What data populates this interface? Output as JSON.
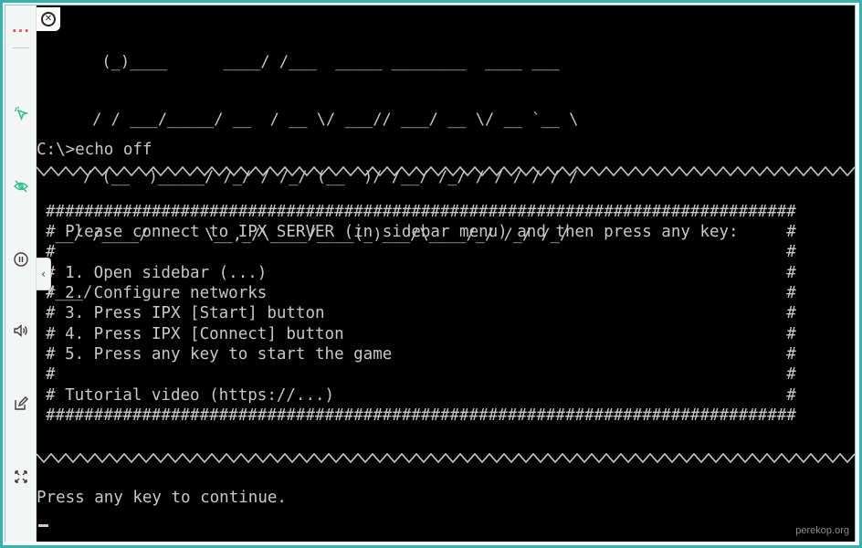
{
  "terminal": {
    "logo_lines": [
      "      (_)____      ____/ /___  _____ ________  ____ ___",
      "     / / ___/_____/ __  / __ \\/ ___// ___/ __ \\/ __ `__ \\",
      "    / (__  )_____/ /_/ / /_/ (__  )/ /__/ /_/ / / / / / /",
      " __/ /____/      \\__,_/\\____/____(_)___/\\____/_/ /_/ /_/",
      "/___/"
    ],
    "prompt_line": "C:\\>echo off",
    "box_lines": [
      "##############################################################################",
      "# Please connect to IPX SERVER (in sidebar menu) and then press any key:     #",
      "#                                                                            #",
      "# 1. Open sidebar (...)                                                      #",
      "# 2. Configure networks                                                      #",
      "# 3. Press IPX [Start] button                                                #",
      "# 4. Press IPX [Connect] button                                              #",
      "# 5. Press any key to start the game                                         #",
      "#                                                                            #",
      "# Tutorial video (https://...)                                               #",
      "##############################################################################"
    ],
    "continue_line": "Press any key to continue."
  },
  "sidebar": {
    "icons": [
      "more-dots-icon",
      "cursor-click-icon",
      "eye-off-icon",
      "pause-icon",
      "volume-icon",
      "edit-icon",
      "fullscreen-icon"
    ]
  },
  "watermark": "perekop.org",
  "colors": {
    "frame": "#36b3ae",
    "terminal_bg": "#000000",
    "terminal_fg": "#c8c8c8",
    "accent_green": "#2dbf8a"
  }
}
